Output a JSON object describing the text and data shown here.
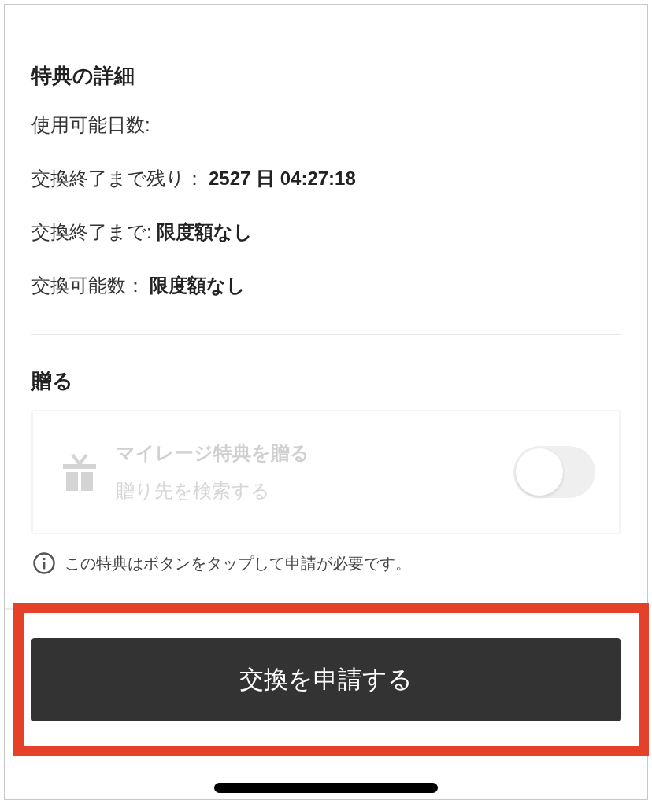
{
  "details": {
    "title": "特典の詳細",
    "rows": [
      {
        "label": "使用可能日数:"
      },
      {
        "label": "交換終了まで残り：",
        "value": "2527 日 04:27:18"
      },
      {
        "label": "交換終了まで:",
        "value": "限度額なし"
      },
      {
        "label": "交換可能数：",
        "value": "限度額なし"
      }
    ]
  },
  "gift": {
    "title": "贈る",
    "card": {
      "title": "マイレージ特典を贈る",
      "subtitle": "贈り先を検索する",
      "disabled": true,
      "toggle": {
        "on": false
      }
    }
  },
  "notice": "この特典はボタンをタップして申請が必要です。",
  "action_button": {
    "label": "交換を申請する",
    "highlighted": true
  }
}
